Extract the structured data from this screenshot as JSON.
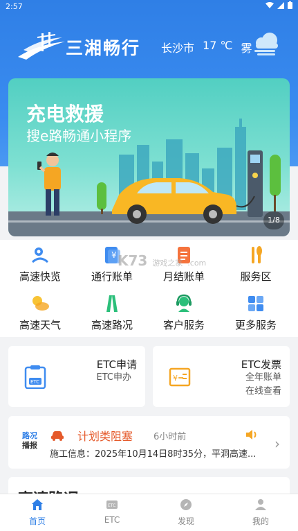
{
  "status": {
    "time": "2:57"
  },
  "header": {
    "brand": "三湘畅行",
    "city": "长沙市",
    "temperature": "17 ℃",
    "weather": "雾",
    "weather_icon": "fog-cloud-icon"
  },
  "banner": {
    "title": "充电救援",
    "subtitle": "搜e路畅通小程序",
    "pager": "1/8"
  },
  "services": [
    {
      "label": "高速快览",
      "icon": "map-pin-icon"
    },
    {
      "label": "通行账单",
      "icon": "bill-icon"
    },
    {
      "label": "月结账单",
      "icon": "monthly-bill-icon"
    },
    {
      "label": "服务区",
      "icon": "fork-knife-icon"
    },
    {
      "label": "高速天气",
      "icon": "sun-cloud-icon"
    },
    {
      "label": "高速路况",
      "icon": "road-icon"
    },
    {
      "label": "客户服务",
      "icon": "headset-icon"
    },
    {
      "label": "更多服务",
      "icon": "grid-icon"
    }
  ],
  "watermark": {
    "main": "K73",
    "sub": "游戏之家",
    "small": ".com"
  },
  "etc_apply": {
    "title": "ETC申请",
    "subtitle": "ETC申办"
  },
  "etc_invoice": {
    "title": "ETC发票",
    "line1": "全年账单",
    "line2": "在线查看"
  },
  "notice": {
    "badge_top": "路况",
    "badge_bottom": "播报",
    "title": "计划类阻塞",
    "ago": "6小时前",
    "description": "施工信息：2025年10月14日8时35分，平洞高速..."
  },
  "section": {
    "title": "高速路况"
  },
  "tabs": [
    {
      "label": "首页",
      "icon": "home-icon",
      "active": true
    },
    {
      "label": "ETC",
      "icon": "etc-card-icon",
      "active": false
    },
    {
      "label": "发现",
      "icon": "compass-icon",
      "active": false
    },
    {
      "label": "我的",
      "icon": "user-icon",
      "active": false
    }
  ],
  "colors": {
    "primary": "#2f7fe6",
    "alert": "#e55a2b",
    "banner": "#52cfc2"
  }
}
